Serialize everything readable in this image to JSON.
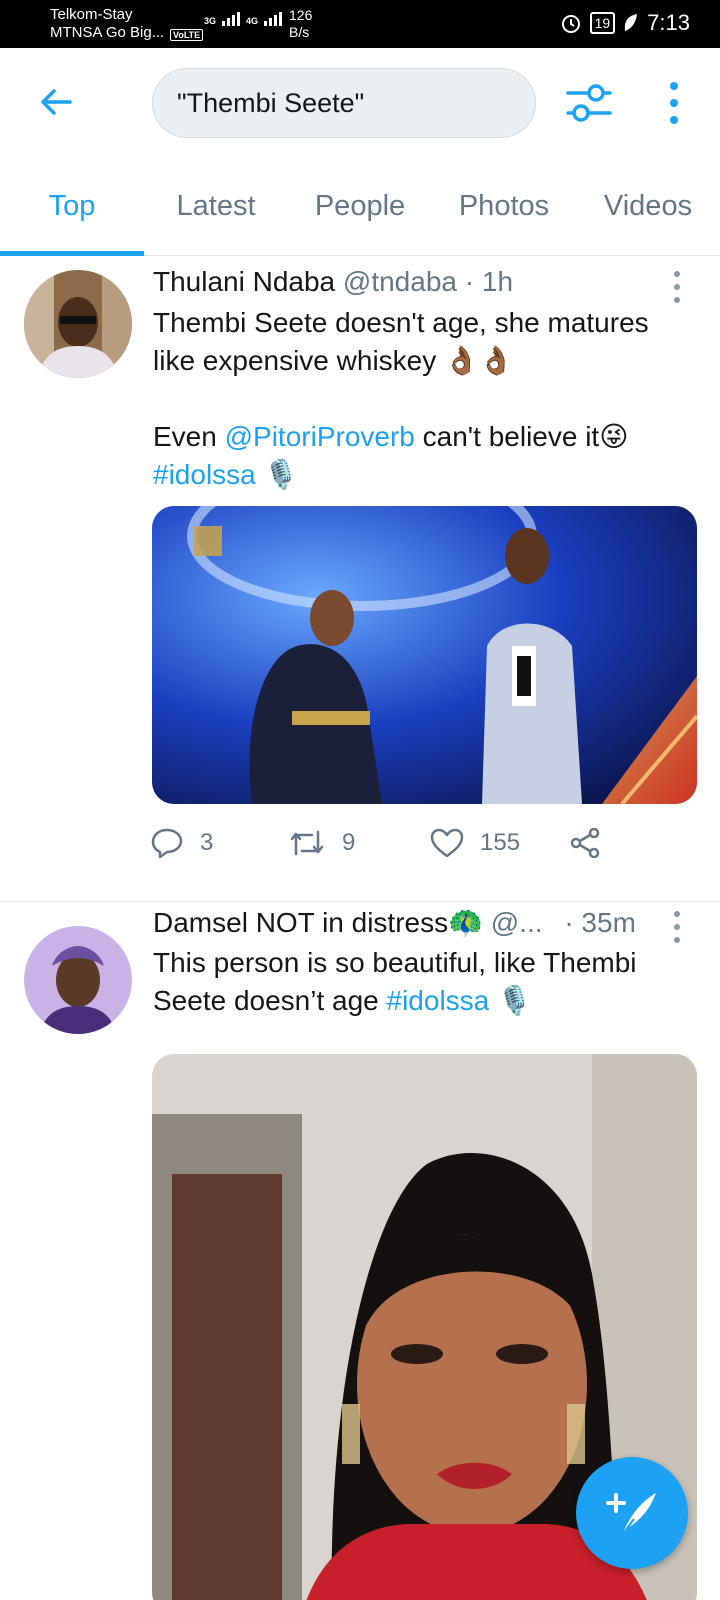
{
  "statusbar": {
    "carrier_1": "Telkom-Stay",
    "carrier_2": "MTNSA Go Big...",
    "net_1": "3G",
    "net_2": "4G",
    "volte": "VoLTE",
    "speed_value": "126",
    "speed_unit": "B/s",
    "battery": "19",
    "time": "7:13"
  },
  "header": {
    "search_value": "\"Thembi Seete\""
  },
  "tabs": [
    {
      "label": "Top",
      "active": true
    },
    {
      "label": "Latest",
      "active": false
    },
    {
      "label": "People",
      "active": false
    },
    {
      "label": "Photos",
      "active": false
    },
    {
      "label": "Videos",
      "active": false
    }
  ],
  "tweets": [
    {
      "name": "Thulani Ndaba",
      "handle": "@tndaba",
      "sep": "·",
      "time": "1h",
      "text_bold_1": "Thembi Seete",
      "text_1": " doesn't age, she matures like expensive whiskey ",
      "emoji_1": "👌🏾👌🏾",
      "text_2": "Even ",
      "mention": "@PitoriProverb",
      "text_3": " can't believe it",
      "emoji_2": "😜",
      "hashtag": "#idolssa",
      "emoji_3": "🎙️",
      "replies": "3",
      "retweets": "9",
      "likes": "155"
    },
    {
      "name": "Damsel NOT in distress",
      "name_emoji": "🦚",
      "handle": "@...",
      "sep": "·",
      "time": "35m",
      "text_1": "This person is so beautiful, like ",
      "text_bold_1": "Thembi Seete",
      "text_2": " doesn’t age ",
      "hashtag": "#idolssa",
      "emoji_1": "🎙️"
    }
  ],
  "colors": {
    "accent": "#1da1f2",
    "text": "#14171a",
    "secondary": "#657786"
  },
  "icons": [
    "back-arrow-icon",
    "filter-icon",
    "more-vertical-icon",
    "reply-icon",
    "retweet-icon",
    "like-icon",
    "share-icon",
    "compose-icon"
  ]
}
